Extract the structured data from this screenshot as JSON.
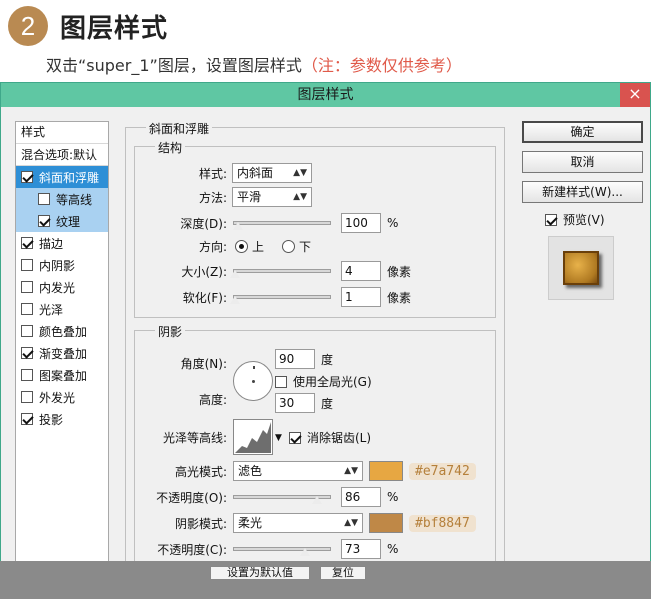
{
  "header": {
    "step": "2",
    "title": "图层样式",
    "subtitle": "双击“super_1”图层，设置图层样式",
    "note": "（注：参数仅供参考）"
  },
  "dialog": {
    "title": "图层样式",
    "close": "×"
  },
  "style_list": {
    "header": "样式",
    "blend": "混合选项:默认",
    "items": [
      {
        "label": "斜面和浮雕",
        "checked": true
      },
      {
        "label": "等高线",
        "checked": false
      },
      {
        "label": "纹理",
        "checked": true
      },
      {
        "label": "描边",
        "checked": true
      },
      {
        "label": "内阴影",
        "checked": false
      },
      {
        "label": "内发光",
        "checked": false
      },
      {
        "label": "光泽",
        "checked": false
      },
      {
        "label": "颜色叠加",
        "checked": false
      },
      {
        "label": "渐变叠加",
        "checked": true
      },
      {
        "label": "图案叠加",
        "checked": false
      },
      {
        "label": "外发光",
        "checked": false
      },
      {
        "label": "投影",
        "checked": true
      }
    ]
  },
  "bevel": {
    "group_title": "斜面和浮雕",
    "structure_title": "结构",
    "style_label": "样式:",
    "style_value": "内斜面",
    "method_label": "方法:",
    "method_value": "平滑",
    "depth_label": "深度(D):",
    "depth_value": "100",
    "depth_unit": "%",
    "depth_level": 0.05,
    "direction_label": "方向:",
    "dir_up": "上",
    "dir_down": "下",
    "size_label": "大小(Z):",
    "size_value": "4",
    "size_unit": "像素",
    "size_level": 0.02,
    "soften_label": "软化(F):",
    "soften_value": "1",
    "soften_unit": "像素",
    "soften_level": 0.02
  },
  "shading": {
    "title": "阴影",
    "angle_label": "角度(N):",
    "angle_value": "90",
    "angle_unit": "度",
    "global_light": "使用全局光(G)",
    "altitude_label": "高度:",
    "altitude_value": "30",
    "altitude_unit": "度",
    "gloss_label": "光泽等高线:",
    "antialias": "消除锯齿(L)",
    "highlight_label": "高光模式:",
    "highlight_mode": "滤色",
    "highlight_color": "#e7a742",
    "highlight_hex": "#e7a742",
    "hl_opacity_label": "不透明度(O):",
    "hl_opacity_value": "86",
    "hl_opacity_level": 0.86,
    "shadow_label": "阴影模式:",
    "shadow_mode": "柔光",
    "shadow_color": "#bf8847",
    "shadow_hex": "#bf8847",
    "sh_opacity_label": "不透明度(C):",
    "sh_opacity_value": "73",
    "sh_opacity_level": 0.73,
    "percent": "%"
  },
  "buttons": {
    "ok": "确定",
    "cancel": "取消",
    "new_style": "新建样式(W)...",
    "preview": "预览(V)",
    "set_default": "设置为默认值",
    "reset": "复位"
  }
}
